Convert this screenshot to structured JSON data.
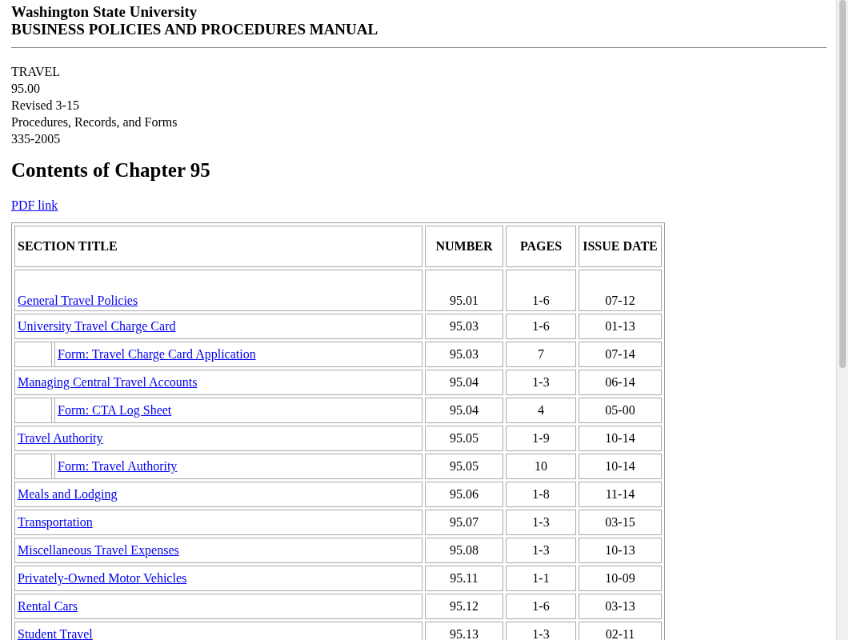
{
  "header": {
    "org": "Washington State University",
    "manual": "BUSINESS POLICIES AND PROCEDURES MANUAL"
  },
  "meta_lines": [
    "TRAVEL",
    "95.00",
    "Revised 3-15",
    "Procedures, Records, and Forms",
    "335-2005"
  ],
  "heading": "Contents of Chapter 95",
  "pdf_link": "PDF link",
  "table": {
    "columns": [
      "SECTION TITLE",
      "NUMBER",
      "PAGES",
      "ISSUE DATE"
    ],
    "rows": [
      {
        "kind": "section",
        "title": "General Travel Policies",
        "number": "95.01",
        "pages": "1-6",
        "issue_date": "07-12"
      },
      {
        "kind": "section",
        "title": "University Travel Charge Card",
        "number": "95.03",
        "pages": "1-6",
        "issue_date": "01-13"
      },
      {
        "kind": "form",
        "title": "Form: Travel Charge Card Application",
        "number": "95.03",
        "pages": "7",
        "issue_date": "07-14"
      },
      {
        "kind": "section",
        "title": "Managing Central Travel Accounts",
        "number": "95.04",
        "pages": "1-3",
        "issue_date": "06-14"
      },
      {
        "kind": "form",
        "title": "Form: CTA Log Sheet",
        "number": "95.04",
        "pages": "4",
        "issue_date": "05-00"
      },
      {
        "kind": "section",
        "title": "Travel Authority",
        "number": "95.05",
        "pages": "1-9",
        "issue_date": "10-14"
      },
      {
        "kind": "form",
        "title": "Form: Travel Authority",
        "number": "95.05",
        "pages": "10",
        "issue_date": "10-14"
      },
      {
        "kind": "section",
        "title": "Meals and Lodging",
        "number": "95.06",
        "pages": "1-8",
        "issue_date": "11-14"
      },
      {
        "kind": "section",
        "title": "Transportation",
        "number": "95.07",
        "pages": "1-3",
        "issue_date": "03-15"
      },
      {
        "kind": "section",
        "title": "Miscellaneous Travel Expenses",
        "number": "95.08",
        "pages": "1-3",
        "issue_date": "10-13"
      },
      {
        "kind": "section",
        "title": "Privately-Owned Motor Vehicles",
        "number": "95.11",
        "pages": "1-1",
        "issue_date": "10-09"
      },
      {
        "kind": "section",
        "title": "Rental Cars",
        "number": "95.12",
        "pages": "1-6",
        "issue_date": "03-13"
      },
      {
        "kind": "section",
        "title": "Student Travel",
        "number": "95.13",
        "pages": "1-3",
        "issue_date": "02-11"
      }
    ]
  }
}
